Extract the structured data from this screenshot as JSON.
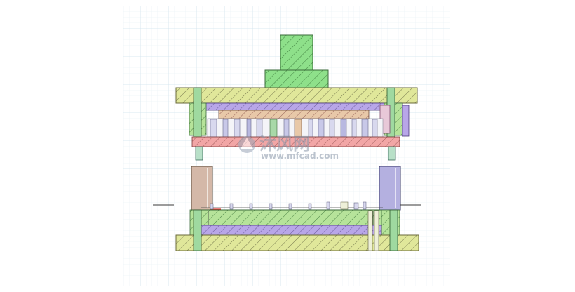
{
  "watermark": {
    "brand_cn": "沐风网",
    "url": "www.mfcad.com"
  },
  "colors": {
    "grid": "#dcebf3",
    "plate_yellow": "#e0e79a",
    "punch_green": "#8ee08a",
    "pink_plate": "#f2a6a6",
    "purple_plate": "#b8a6e8",
    "tan_plate": "#e8c8a8",
    "guide_tan": "#d4b8a8",
    "guide_purple": "#b4b0e0",
    "die_green": "#b6e39a",
    "outline": "#4a4a4a"
  }
}
